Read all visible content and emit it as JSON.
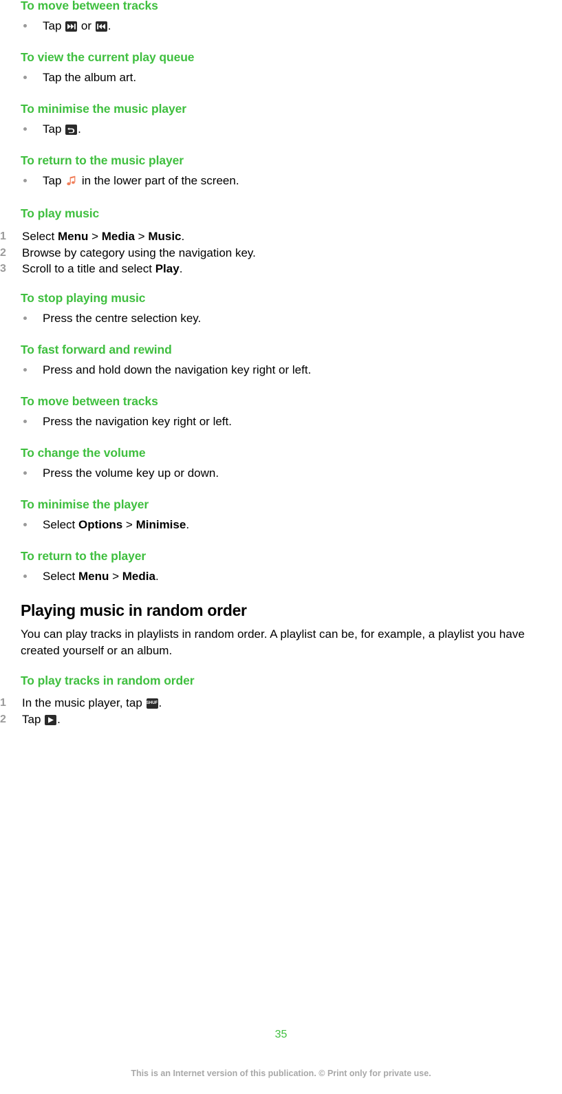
{
  "document": {
    "page_number": "35",
    "footer_note": "This is an Internet version of this publication. © Print only for private use.",
    "heading_color": "#3fbf3f",
    "marker_color": "#9a9a9a",
    "icon_bg_color": "#2b2b2b",
    "note_icon_color": "#f07a5a"
  },
  "sections": [
    {
      "heading": "To move between tracks",
      "items": [
        {
          "marker": "bullet",
          "pre": "Tap ",
          "icon1": "next-track-icon",
          "mid": " or ",
          "icon2": "previous-track-icon",
          "post": "."
        }
      ]
    },
    {
      "heading": "To view the current play queue",
      "items": [
        {
          "marker": "bullet",
          "text": "Tap the album art."
        }
      ]
    },
    {
      "heading": "To minimise the music player",
      "items": [
        {
          "marker": "bullet",
          "pre": "Tap ",
          "icon1": "back-icon",
          "post": "."
        }
      ]
    },
    {
      "heading": "To return to the music player",
      "items": [
        {
          "marker": "bullet",
          "pre": "Tap ",
          "icon1": "music-note-icon",
          "post": " in the lower part of the screen."
        }
      ]
    },
    {
      "heading": "To play music",
      "items": [
        {
          "marker": "1",
          "seg": [
            "Select ",
            "Menu",
            " > ",
            "Media",
            " > ",
            "Music",
            "."
          ]
        },
        {
          "marker": "2",
          "text": "Browse by category using the navigation key."
        },
        {
          "marker": "3",
          "seg": [
            "Scroll to a title and select ",
            "Play",
            "."
          ]
        }
      ]
    },
    {
      "heading": "To stop playing music",
      "items": [
        {
          "marker": "bullet",
          "text": "Press the centre selection key."
        }
      ]
    },
    {
      "heading": "To fast forward and rewind",
      "items": [
        {
          "marker": "bullet",
          "text": "Press and hold down the navigation key right or left."
        }
      ]
    },
    {
      "heading": "To move between tracks",
      "items": [
        {
          "marker": "bullet",
          "text": "Press the navigation key right or left."
        }
      ]
    },
    {
      "heading": "To change the volume",
      "items": [
        {
          "marker": "bullet",
          "text": "Press the volume key up or down."
        }
      ]
    },
    {
      "heading": "To minimise the player",
      "items": [
        {
          "marker": "bullet",
          "seg": [
            "Select ",
            "Options",
            " > ",
            "Minimise",
            "."
          ]
        }
      ]
    },
    {
      "heading": "To return to the player",
      "items": [
        {
          "marker": "bullet",
          "seg": [
            "Select ",
            "Menu",
            " > ",
            "Media",
            "."
          ]
        }
      ]
    }
  ],
  "random_order": {
    "section_title": "Playing music in random order",
    "paragraph": "You can play tracks in playlists in random order. A playlist can be, for example, a playlist you have created yourself or an album.",
    "task_heading": "To play tracks in random order",
    "steps": [
      {
        "marker": "1",
        "pre": "In the music player, tap ",
        "icon1": "shuffle-icon",
        "post": "."
      },
      {
        "marker": "2",
        "pre": "Tap ",
        "icon1": "play-icon",
        "post": "."
      }
    ]
  },
  "labels": {
    "menu": "Menu",
    "media": "Media",
    "music": "Music",
    "play": "Play",
    "options": "Options",
    "minimise": "Minimise",
    "shuffle_icon_text": "SHUF"
  }
}
